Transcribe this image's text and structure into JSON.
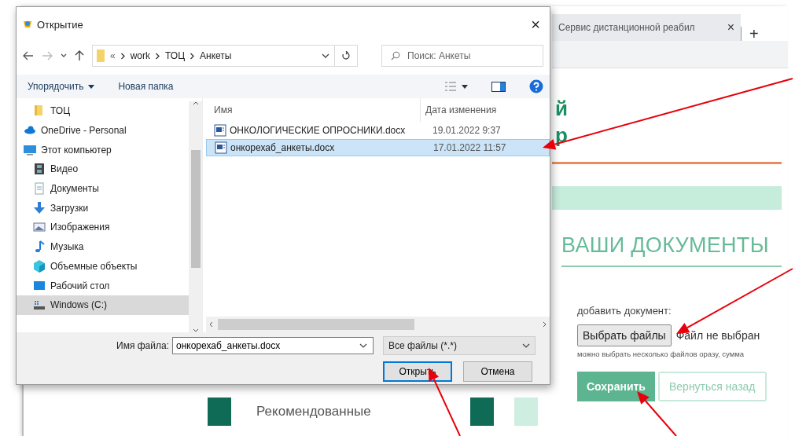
{
  "browser": {
    "tab_title": "Сервис дистанционной реабил",
    "tab_close": "×",
    "new_tab": "+"
  },
  "page": {
    "title_fragments": [
      "й",
      "р"
    ],
    "section_heading": "ВАШИ ДОКУМЕНТЫ",
    "upload_label": "добавить документ:",
    "choose_button": "Выбрать файлы",
    "no_file_text": "Файл не выбран",
    "hint": "можно выбрать несколько файлов оразу, сумма",
    "save_button": "Сохранить",
    "back_button": "Вернуться назад",
    "recommended_label": "Рекомендованные"
  },
  "dialog": {
    "title": "Открытие",
    "close": "×",
    "address": {
      "overflow": "«",
      "path": [
        "work",
        "ТОЦ",
        "Анкеты"
      ]
    },
    "search": {
      "placeholder": "Поиск: Анкеты"
    },
    "toolbar": {
      "organize": "Упорядочить",
      "new_folder": "Новая папка"
    },
    "nav": {
      "partial_children": [
        {
          "label": "ТОЦ",
          "kind": "folder",
          "selected": false
        }
      ],
      "items": [
        {
          "label": "OneDrive - Personal",
          "kind": "cloud",
          "selected": false
        },
        {
          "label": "Этот компьютер",
          "kind": "computer",
          "selected": false,
          "children": [
            {
              "label": "Видео",
              "kind": "video",
              "selected": false
            },
            {
              "label": "Документы",
              "kind": "documents",
              "selected": false
            },
            {
              "label": "Загрузки",
              "kind": "downloads",
              "selected": false
            },
            {
              "label": "Изображения",
              "kind": "pictures",
              "selected": false
            },
            {
              "label": "Музыка",
              "kind": "music",
              "selected": false
            },
            {
              "label": "Объемные объекты",
              "kind": "objects3d",
              "selected": false
            },
            {
              "label": "Рабочий стол",
              "kind": "desktop",
              "selected": false
            },
            {
              "label": "Windows (C:)",
              "kind": "drive",
              "selected": true
            }
          ]
        }
      ]
    },
    "files": {
      "columns": [
        "Имя",
        "Дата изменения"
      ],
      "rows": [
        {
          "name": "ОНКОЛОГИЧЕСКИЕ ОПРОСНИКИ.docx",
          "modified": "19.01.2022 9:37",
          "selected": false
        },
        {
          "name": "онкорехаб_анкеты.docx",
          "modified": "17.01.2022 11:57",
          "selected": true
        }
      ]
    },
    "footer": {
      "filename_label": "Имя файла:",
      "filename": "онкорехаб_анкеты.docx",
      "filter": "Все файлы (*.*)",
      "buttons": [
        {
          "label": "Открыть",
          "default": true
        },
        {
          "label": "Отмена",
          "default": false
        }
      ]
    }
  }
}
